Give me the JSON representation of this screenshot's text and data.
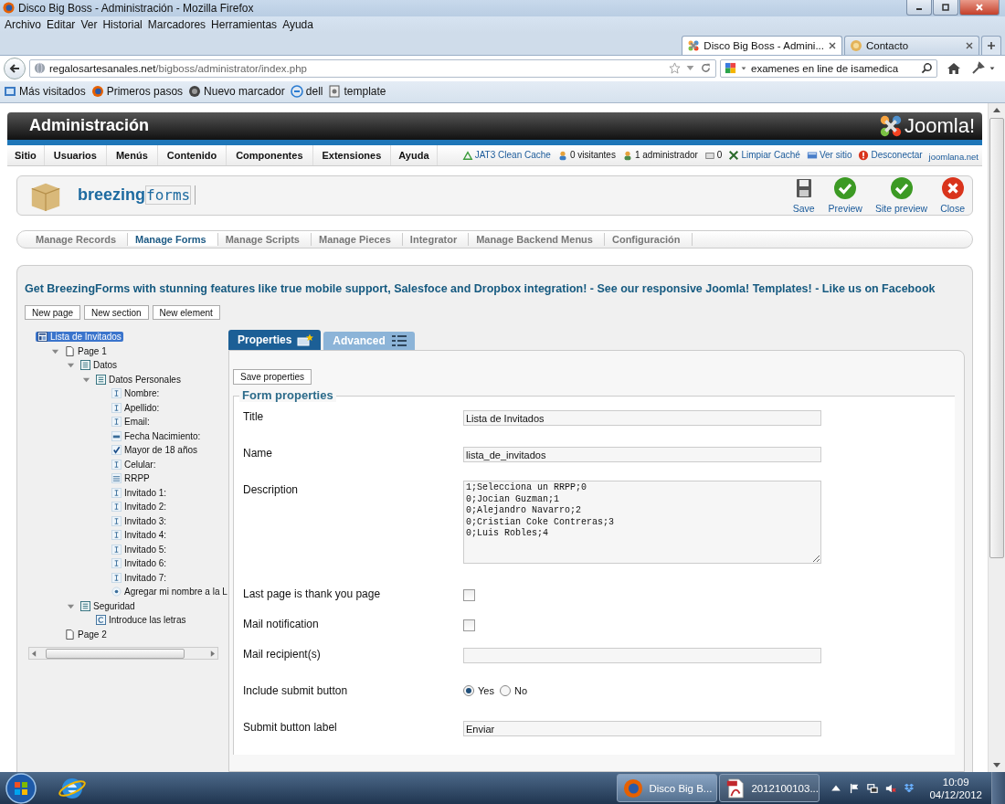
{
  "window": {
    "title": "Disco Big Boss - Administración - Mozilla Firefox"
  },
  "menu": [
    "Archivo",
    "Editar",
    "Ver",
    "Historial",
    "Marcadores",
    "Herramientas",
    "Ayuda"
  ],
  "tabs": [
    {
      "label": "Disco Big Boss - Admini...",
      "kind": "joomla",
      "selected": true
    },
    {
      "label": "Contacto",
      "kind": "site",
      "selected": false
    }
  ],
  "address_bar": {
    "host": "regalosartesanales.net",
    "path": "/bigboss/administrator/index.php"
  },
  "search": {
    "value": "examenes en line de isamedica"
  },
  "bookmarks": [
    {
      "label": "Más visitados",
      "kind": "folder"
    },
    {
      "label": "Primeros pasos",
      "kind": "firefox"
    },
    {
      "label": "Nuevo marcador",
      "kind": "globe"
    },
    {
      "label": "dell",
      "kind": "dell"
    },
    {
      "label": "template",
      "kind": "page"
    }
  ],
  "admin": {
    "title": "Administración",
    "logo_text": "Joomla!",
    "menu": [
      "Sitio",
      "Usuarios",
      "Menús",
      "Contenido",
      "Componentes",
      "Extensiones",
      "Ayuda"
    ],
    "status": [
      {
        "label": "JAT3 Clean Cache",
        "kind": "cache"
      },
      {
        "label": "0 visitantes",
        "kind": "visitors"
      },
      {
        "label": "1 administrador",
        "kind": "admins"
      },
      {
        "label": "0",
        "kind": "messages"
      },
      {
        "label": "Limpiar Caché",
        "kind": "clear"
      },
      {
        "label": "Ver sitio",
        "kind": "view"
      },
      {
        "label": "Desconectar",
        "kind": "logout"
      },
      {
        "label": "joomlana.net",
        "kind": "link"
      }
    ]
  },
  "component": {
    "logo_bold": "breezing",
    "logo_light": "forms",
    "toolbar": [
      {
        "label": "Save",
        "kind": "save"
      },
      {
        "label": "Preview",
        "kind": "preview"
      },
      {
        "label": "Site preview",
        "kind": "preview"
      },
      {
        "label": "Close",
        "kind": "close"
      }
    ]
  },
  "submenu": [
    {
      "label": "Manage Records",
      "selected": false
    },
    {
      "label": "Manage Forms",
      "selected": true
    },
    {
      "label": "Manage Scripts",
      "selected": false
    },
    {
      "label": "Manage Pieces",
      "selected": false
    },
    {
      "label": "Integrator",
      "selected": false
    },
    {
      "label": "Manage Backend Menus",
      "selected": false
    },
    {
      "label": "Configuración",
      "selected": false
    }
  ],
  "promo": "Get BreezingForms with stunning features like true mobile support, Salesfoce and Dropbox integration! - See our responsive Joomla! Templates! - Like us on Facebook",
  "tree_buttons": [
    "New page",
    "New section",
    "New element"
  ],
  "tree": {
    "label": "Lista de Invitados",
    "kind": "form",
    "selected": true,
    "children": [
      {
        "label": "Page 1",
        "kind": "page",
        "selected": false,
        "children": [
          {
            "label": "Datos",
            "kind": "section",
            "selected": false,
            "children": [
              {
                "label": "Datos Personales",
                "kind": "section",
                "selected": false,
                "children": [
                  {
                    "label": "Nombre:",
                    "kind": "text",
                    "selected": false
                  },
                  {
                    "label": "Apellido:",
                    "kind": "text",
                    "selected": false
                  },
                  {
                    "label": "Email:",
                    "kind": "text",
                    "selected": false
                  },
                  {
                    "label": "Fecha Nacimiento:",
                    "kind": "date",
                    "selected": false
                  },
                  {
                    "label": "Mayor de 18 años",
                    "kind": "checkbox",
                    "selected": false
                  },
                  {
                    "label": "Celular:",
                    "kind": "text",
                    "selected": false
                  },
                  {
                    "label": "RRPP",
                    "kind": "select",
                    "selected": false
                  },
                  {
                    "label": "Invitado 1:",
                    "kind": "text",
                    "selected": false
                  },
                  {
                    "label": "Invitado 2:",
                    "kind": "text",
                    "selected": false
                  },
                  {
                    "label": "Invitado 3:",
                    "kind": "text",
                    "selected": false
                  },
                  {
                    "label": "Invitado 4:",
                    "kind": "text",
                    "selected": false
                  },
                  {
                    "label": "Invitado 5:",
                    "kind": "text",
                    "selected": false
                  },
                  {
                    "label": "Invitado 6:",
                    "kind": "text",
                    "selected": false
                  },
                  {
                    "label": "Invitado 7:",
                    "kind": "text",
                    "selected": false
                  },
                  {
                    "label": "Agregar mi nombre a la L",
                    "kind": "radio",
                    "selected": false
                  }
                ]
              }
            ]
          },
          {
            "label": "Seguridad",
            "kind": "section",
            "selected": false,
            "children": [
              {
                "label": "Introduce las letras",
                "kind": "captcha",
                "selected": false
              }
            ]
          }
        ]
      },
      {
        "label": "Page 2",
        "kind": "page",
        "selected": false
      }
    ]
  },
  "properties_tabs": [
    {
      "label": "Properties",
      "kind": "properties",
      "selected": true
    },
    {
      "label": "Advanced",
      "kind": "advanced",
      "selected": false
    }
  ],
  "save_properties": "Save properties",
  "form_properties": {
    "legend": "Form properties",
    "rows": [
      {
        "label": "Title",
        "kind": "text",
        "value": "Lista de Invitados"
      },
      {
        "label": "Name",
        "kind": "text",
        "value": "lista_de_invitados"
      },
      {
        "label": "Description",
        "kind": "textarea",
        "value": "1;Selecciona un RRPP;0\n0;Jocian Guzman;1\n0;Alejandro Navarro;2\n0;Cristian Coke Contreras;3\n0;Luis Robles;4"
      },
      {
        "label": "Last page is thank you page",
        "kind": "checkbox",
        "checked": false
      },
      {
        "label": "Mail notification",
        "kind": "checkbox",
        "checked": false
      },
      {
        "label": "Mail recipient(s)",
        "kind": "text"
      },
      {
        "label": "Include submit button",
        "kind": "radio",
        "options": [
          {
            "label": "Yes",
            "selected": true
          },
          {
            "label": "No",
            "selected": false
          }
        ]
      },
      {
        "label": "Submit button label",
        "kind": "text",
        "value": "Enviar"
      }
    ]
  },
  "taskbar": {
    "tasks": [
      {
        "label": "Disco Big B...",
        "kind": "firefox",
        "selected": true
      },
      {
        "label": "2012100103...",
        "kind": "pdf",
        "selected": false
      }
    ],
    "time": "10:09",
    "date": "04/12/2012"
  }
}
